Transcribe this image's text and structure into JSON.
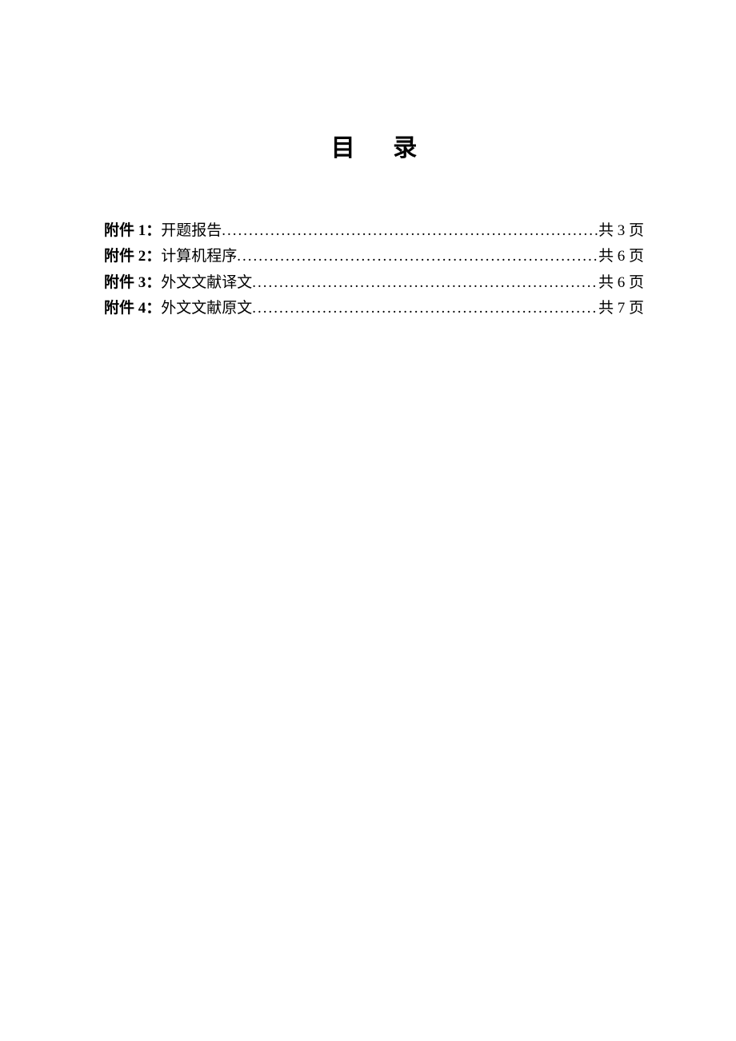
{
  "title": "目 录",
  "toc": {
    "items": [
      {
        "label": "附件 1：",
        "text": "开题报告",
        "pages": "共 3 页"
      },
      {
        "label": "附件 2：",
        "text": "计算机程序",
        "pages": "共 6 页"
      },
      {
        "label": "附件 3：",
        "text": "外文文献译文",
        "pages": "共 6 页"
      },
      {
        "label": "附件 4：",
        "text": "外文文献原文",
        "pages": "共 7 页"
      }
    ]
  },
  "dots": "................................................................................"
}
